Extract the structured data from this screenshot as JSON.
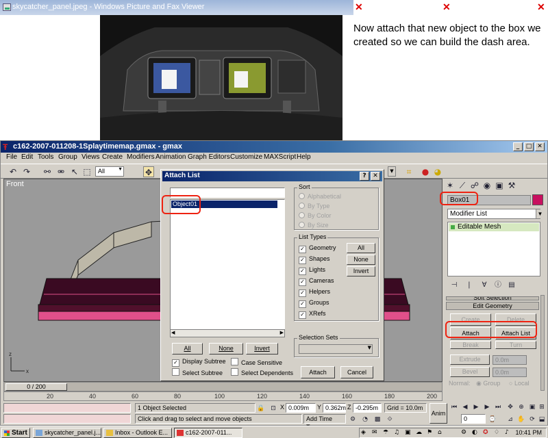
{
  "picture_viewer": {
    "title": "skycatcher_panel.jpeg - Windows Picture and Fax Viewer"
  },
  "tutorial_text": "Now attach that new object to the box we created so we can build the dash area.",
  "gmax": {
    "title": "c162-2007-011208-1Splaytimemap.gmax - gmax",
    "menu": [
      "File",
      "Edit",
      "Tools",
      "Group",
      "Views",
      "Create",
      "Modifiers",
      "Animation",
      "Graph Editors",
      "Customize",
      "MAXScript",
      "Help"
    ],
    "selection_filter": "All",
    "viewport_label": "Front",
    "command_panel": {
      "object_name": "Box01",
      "object_color": "#c8105f",
      "modifier_list": "Modifier List",
      "stack_item": "Editable Mesh",
      "soft_selection": "Soft Selection",
      "edit_geometry": "Edit Geometry",
      "create_label": "Create",
      "delete_label": "Delete",
      "attach_label": "Attach",
      "attach_list_label": "Attach List",
      "break_label": "Break",
      "turn_label": "Turn",
      "extrude_label": "Extrude",
      "extrude_value": "0.0m",
      "bevel_label": "Bevel",
      "bevel_value": "0.0m",
      "normal_label": "Normal:",
      "group_label": "Group",
      "local_label": "Local"
    },
    "time_slider": "0 / 200",
    "ruler_ticks": [
      "20",
      "40",
      "60",
      "80",
      "100",
      "120",
      "140",
      "160",
      "180",
      "200"
    ],
    "status": {
      "selection": "1 Object Selected",
      "prompt": "Click and drag to select and move objects",
      "x_label": "X",
      "x_value": "0.009m",
      "y_label": "Y",
      "y_value": "0.362m",
      "z_label": "Z",
      "z_value": "-0.295m",
      "grid": "Grid = 10.0m",
      "add_time_tag": "Add Time Tag",
      "anim": "Anim",
      "frame": "0"
    }
  },
  "dialog": {
    "title": "Attach List",
    "objects": [
      "Object01"
    ],
    "sort_label": "Sort",
    "sort_options": [
      "Alphabetical",
      "By Type",
      "By Color",
      "By Size"
    ],
    "list_types_label": "List Types",
    "list_types": [
      "Geometry",
      "Shapes",
      "Lights",
      "Cameras",
      "Helpers",
      "Groups",
      "XRefs"
    ],
    "all_label": "All",
    "none_label": "None",
    "invert_label": "Invert",
    "display_subtree": "Display Subtree",
    "case_sensitive": "Case Sensitive",
    "select_subtree": "Select Subtree",
    "select_dependents": "Select Dependents",
    "selection_sets_label": "Selection Sets",
    "attach_label": "Attach",
    "cancel_label": "Cancel"
  },
  "taskbar": {
    "start": "Start",
    "tasks": [
      "skycatcher_panel.j...",
      "Inbox - Outlook E...",
      "c162-2007-011..."
    ],
    "clock": "10:41 PM"
  },
  "colors": {
    "highlight": "#e21b1b",
    "box_top": "#3a0a22",
    "box_stripe": "#e0508a"
  }
}
